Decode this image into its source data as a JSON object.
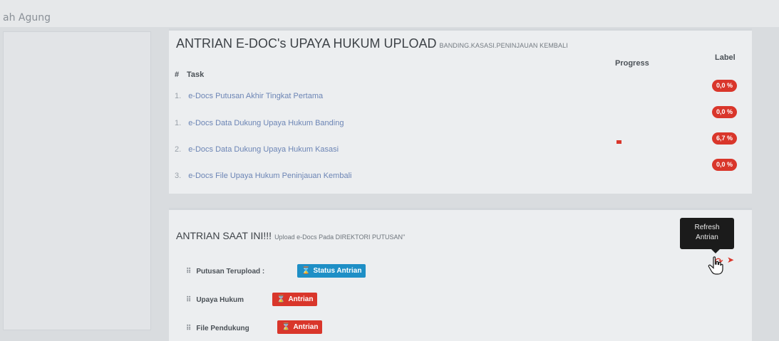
{
  "header": {
    "breadcrumb": "ah Agung"
  },
  "panel1": {
    "title": "ANTRIAN E-DOC's UPAYA HUKUM UPLOAD",
    "subtitle": "BANDING.KASASI.PENINJAUAN KEMBALI",
    "columns": {
      "hash": "#",
      "task": "Task",
      "progress": "Progress",
      "label": "Label"
    },
    "tasks": [
      {
        "num": "1.",
        "name": "e-Docs Putusan Akhir Tingkat Pertama",
        "label": "0,0 %",
        "progress": 0
      },
      {
        "num": "1.",
        "name": "e-Docs Data Dukung Upaya Hukum Banding",
        "label": "0,0 %",
        "progress": 0
      },
      {
        "num": "2.",
        "name": "e-Docs Data Dukung Upaya Hukum Kasasi",
        "label": "6,7 %",
        "progress": 0.067
      },
      {
        "num": "3.",
        "name": "e-Docs File Upaya Hukum Peninjauan Kembali",
        "label": "0,0 %",
        "progress": 0
      }
    ]
  },
  "panel2": {
    "title": "ANTRIAN SAAT INI!!!",
    "subtitle": "Upload e-Docs Pada DIREKTORI PUTUSAN\"",
    "rows": [
      {
        "grip": "⠿",
        "label": "Putusan Terupload :",
        "button": "Status Antrian",
        "color": "#1e8fc6"
      },
      {
        "grip": "⠿",
        "label": "Upaya Hukum",
        "button": "Antrian",
        "color": "#d9362b"
      },
      {
        "grip": "⠿",
        "label": "File Pendukung",
        "button": "Antrian",
        "color": "#d9362b"
      }
    ],
    "tooltip": {
      "line1": "Refresh",
      "line2": "Antrian"
    },
    "icons": {
      "refresh": "refresh-icon",
      "send": "send-icon"
    }
  },
  "colors": {
    "danger": "#d9362b",
    "info": "#1e8fc6",
    "link": "#6c85b5"
  }
}
